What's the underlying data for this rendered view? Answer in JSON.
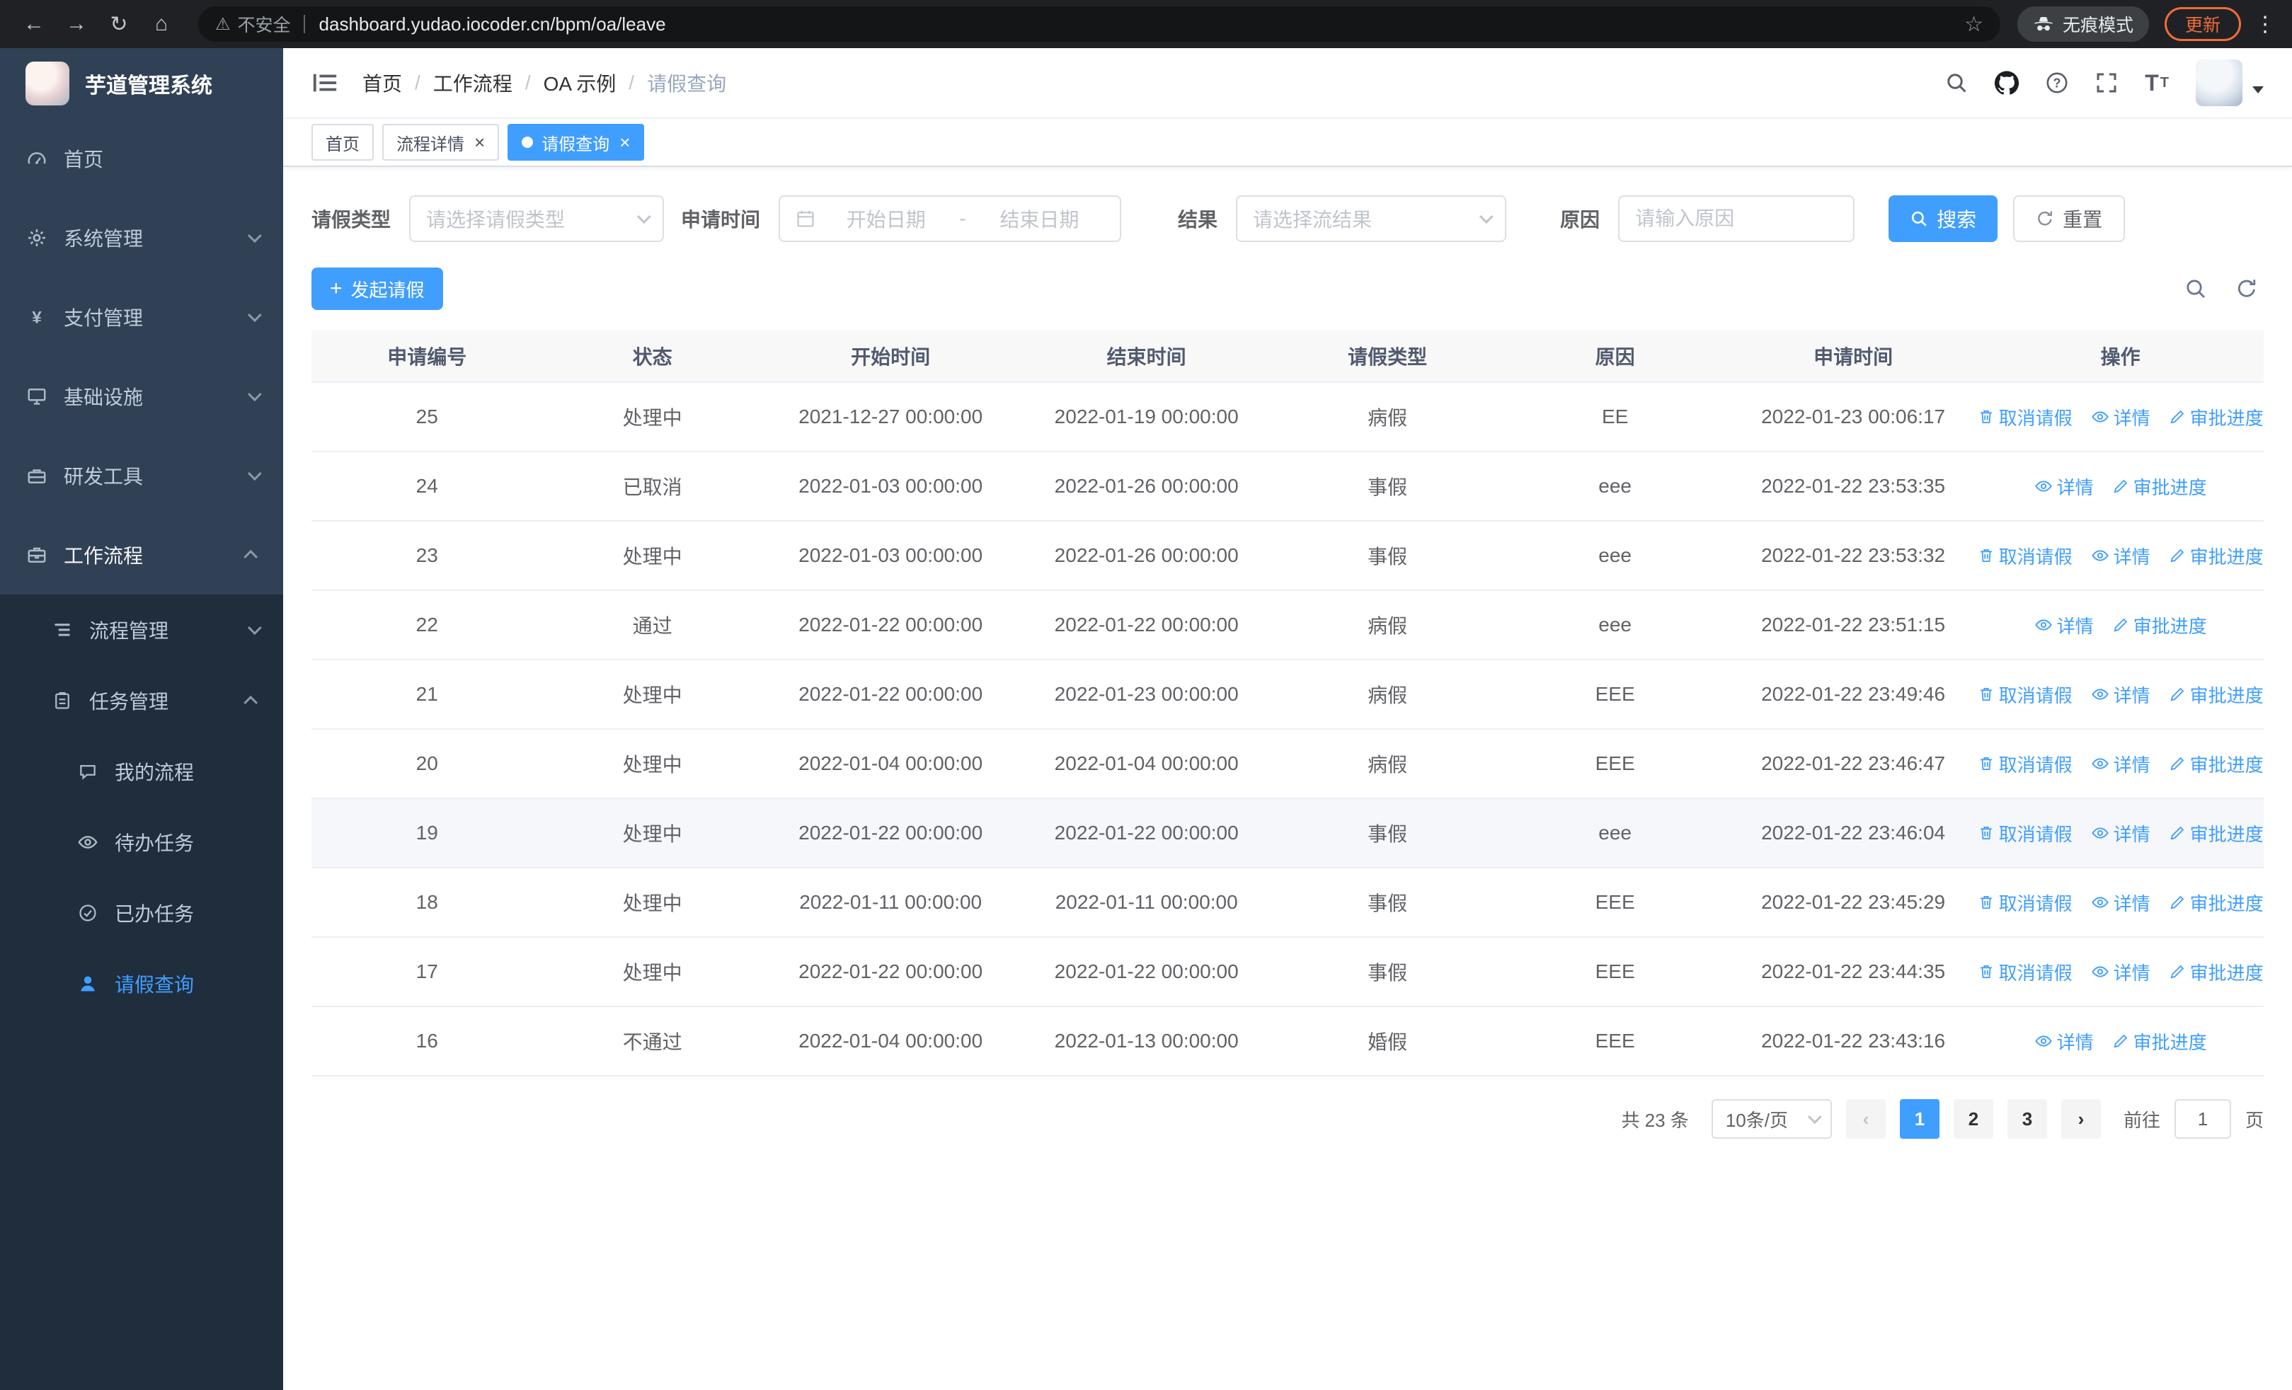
{
  "browser": {
    "security_label": "不安全",
    "url": "dashboard.yudao.iocoder.cn/bpm/oa/leave",
    "incognito_label": "无痕模式",
    "update_label": "更新"
  },
  "sidebar": {
    "title": "芋道管理系统",
    "menu": [
      {
        "name": "sidebar-item-home",
        "label": "首页",
        "icon": "dashboard-icon",
        "level": 1,
        "arrow": ""
      },
      {
        "name": "sidebar-item-system-management",
        "label": "系统管理",
        "icon": "gear-icon",
        "level": 1,
        "arrow": "down"
      },
      {
        "name": "sidebar-item-payment-management",
        "label": "支付管理",
        "icon": "payment-icon",
        "level": 1,
        "arrow": "down"
      },
      {
        "name": "sidebar-item-infrastructure",
        "label": "基础设施",
        "icon": "infrastructure-icon",
        "level": 1,
        "arrow": "down"
      },
      {
        "name": "sidebar-item-dev-tools",
        "label": "研发工具",
        "icon": "devtools-icon",
        "level": 1,
        "arrow": "down"
      },
      {
        "name": "sidebar-item-workflow",
        "label": "工作流程",
        "icon": "workflow-icon",
        "level": 1,
        "arrow": "up",
        "open": true
      },
      {
        "name": "sidebar-item-process-management",
        "label": "流程管理",
        "icon": "process-icon",
        "level": 2,
        "arrow": "down"
      },
      {
        "name": "sidebar-item-task-management",
        "label": "任务管理",
        "icon": "task-icon",
        "level": 2,
        "arrow": "up",
        "open": true
      },
      {
        "name": "sidebar-item-my-process",
        "label": "我的流程",
        "icon": "my-process-icon",
        "level": 3,
        "arrow": ""
      },
      {
        "name": "sidebar-item-todo-tasks",
        "label": "待办任务",
        "icon": "todo-icon",
        "level": 3,
        "arrow": ""
      },
      {
        "name": "sidebar-item-done-tasks",
        "label": "已办任务",
        "icon": "done-icon",
        "level": 3,
        "arrow": ""
      },
      {
        "name": "sidebar-item-leave-query",
        "label": "请假查询",
        "icon": "user-icon",
        "level": 3,
        "arrow": "",
        "active": true
      }
    ]
  },
  "header": {
    "breadcrumb": [
      "首页",
      "工作流程",
      "OA 示例",
      "请假查询"
    ]
  },
  "tabs": [
    {
      "name": "home",
      "label": "首页",
      "closable": false,
      "active": false
    },
    {
      "name": "process-detail",
      "label": "流程详情",
      "closable": true,
      "active": false
    },
    {
      "name": "leave-query",
      "label": "请假查询",
      "closable": true,
      "active": true
    }
  ],
  "filters": {
    "leave_type_label": "请假类型",
    "leave_type_placeholder": "请选择请假类型",
    "apply_time_label": "申请时间",
    "start_date_placeholder": "开始日期",
    "range_separator": "-",
    "end_date_placeholder": "结束日期",
    "result_label": "结果",
    "result_placeholder": "请选择流结果",
    "reason_label": "原因",
    "reason_placeholder": "请输入原因",
    "search_button": "搜索",
    "reset_button": "重置"
  },
  "toolbar": {
    "create_button": "发起请假"
  },
  "table": {
    "columns": [
      "申请编号",
      "状态",
      "开始时间",
      "结束时间",
      "请假类型",
      "原因",
      "申请时间",
      "操作"
    ],
    "action_labels": {
      "cancel": "取消请假",
      "detail": "详情",
      "progress": "审批进度"
    },
    "rows": [
      {
        "id": "25",
        "status": "处理中",
        "start": "2021-12-27 00:00:00",
        "end": "2022-01-19 00:00:00",
        "type": "病假",
        "reason": "EE",
        "applied": "2022-01-23 00:06:17",
        "actions": [
          "cancel",
          "detail",
          "progress"
        ]
      },
      {
        "id": "24",
        "status": "已取消",
        "start": "2022-01-03 00:00:00",
        "end": "2022-01-26 00:00:00",
        "type": "事假",
        "reason": "eee",
        "applied": "2022-01-22 23:53:35",
        "actions": [
          "detail",
          "progress"
        ]
      },
      {
        "id": "23",
        "status": "处理中",
        "start": "2022-01-03 00:00:00",
        "end": "2022-01-26 00:00:00",
        "type": "事假",
        "reason": "eee",
        "applied": "2022-01-22 23:53:32",
        "actions": [
          "cancel",
          "detail",
          "progress"
        ]
      },
      {
        "id": "22",
        "status": "通过",
        "start": "2022-01-22 00:00:00",
        "end": "2022-01-22 00:00:00",
        "type": "病假",
        "reason": "eee",
        "applied": "2022-01-22 23:51:15",
        "actions": [
          "detail",
          "progress"
        ]
      },
      {
        "id": "21",
        "status": "处理中",
        "start": "2022-01-22 00:00:00",
        "end": "2022-01-23 00:00:00",
        "type": "病假",
        "reason": "EEE",
        "applied": "2022-01-22 23:49:46",
        "actions": [
          "cancel",
          "detail",
          "progress"
        ]
      },
      {
        "id": "20",
        "status": "处理中",
        "start": "2022-01-04 00:00:00",
        "end": "2022-01-04 00:00:00",
        "type": "病假",
        "reason": "EEE",
        "applied": "2022-01-22 23:46:47",
        "actions": [
          "cancel",
          "detail",
          "progress"
        ]
      },
      {
        "id": "19",
        "status": "处理中",
        "start": "2022-01-22 00:00:00",
        "end": "2022-01-22 00:00:00",
        "type": "事假",
        "reason": "eee",
        "applied": "2022-01-22 23:46:04",
        "actions": [
          "cancel",
          "detail",
          "progress"
        ],
        "hover": true
      },
      {
        "id": "18",
        "status": "处理中",
        "start": "2022-01-11 00:00:00",
        "end": "2022-01-11 00:00:00",
        "type": "事假",
        "reason": "EEE",
        "applied": "2022-01-22 23:45:29",
        "actions": [
          "cancel",
          "detail",
          "progress"
        ]
      },
      {
        "id": "17",
        "status": "处理中",
        "start": "2022-01-22 00:00:00",
        "end": "2022-01-22 00:00:00",
        "type": "事假",
        "reason": "EEE",
        "applied": "2022-01-22 23:44:35",
        "actions": [
          "cancel",
          "detail",
          "progress"
        ]
      },
      {
        "id": "16",
        "status": "不通过",
        "start": "2022-01-04 00:00:00",
        "end": "2022-01-13 00:00:00",
        "type": "婚假",
        "reason": "EEE",
        "applied": "2022-01-22 23:43:16",
        "actions": [
          "detail",
          "progress"
        ]
      }
    ]
  },
  "pagination": {
    "total_text": "共 23 条",
    "page_size": "10条/页",
    "pages": [
      "1",
      "2",
      "3"
    ],
    "active_page": "1",
    "goto_label": "前往",
    "goto_value": "1",
    "goto_suffix": "页"
  },
  "colors": {
    "accent": "#409eff",
    "sidebar_bg": "#304156",
    "submenu_bg": "#1f2d3d"
  }
}
